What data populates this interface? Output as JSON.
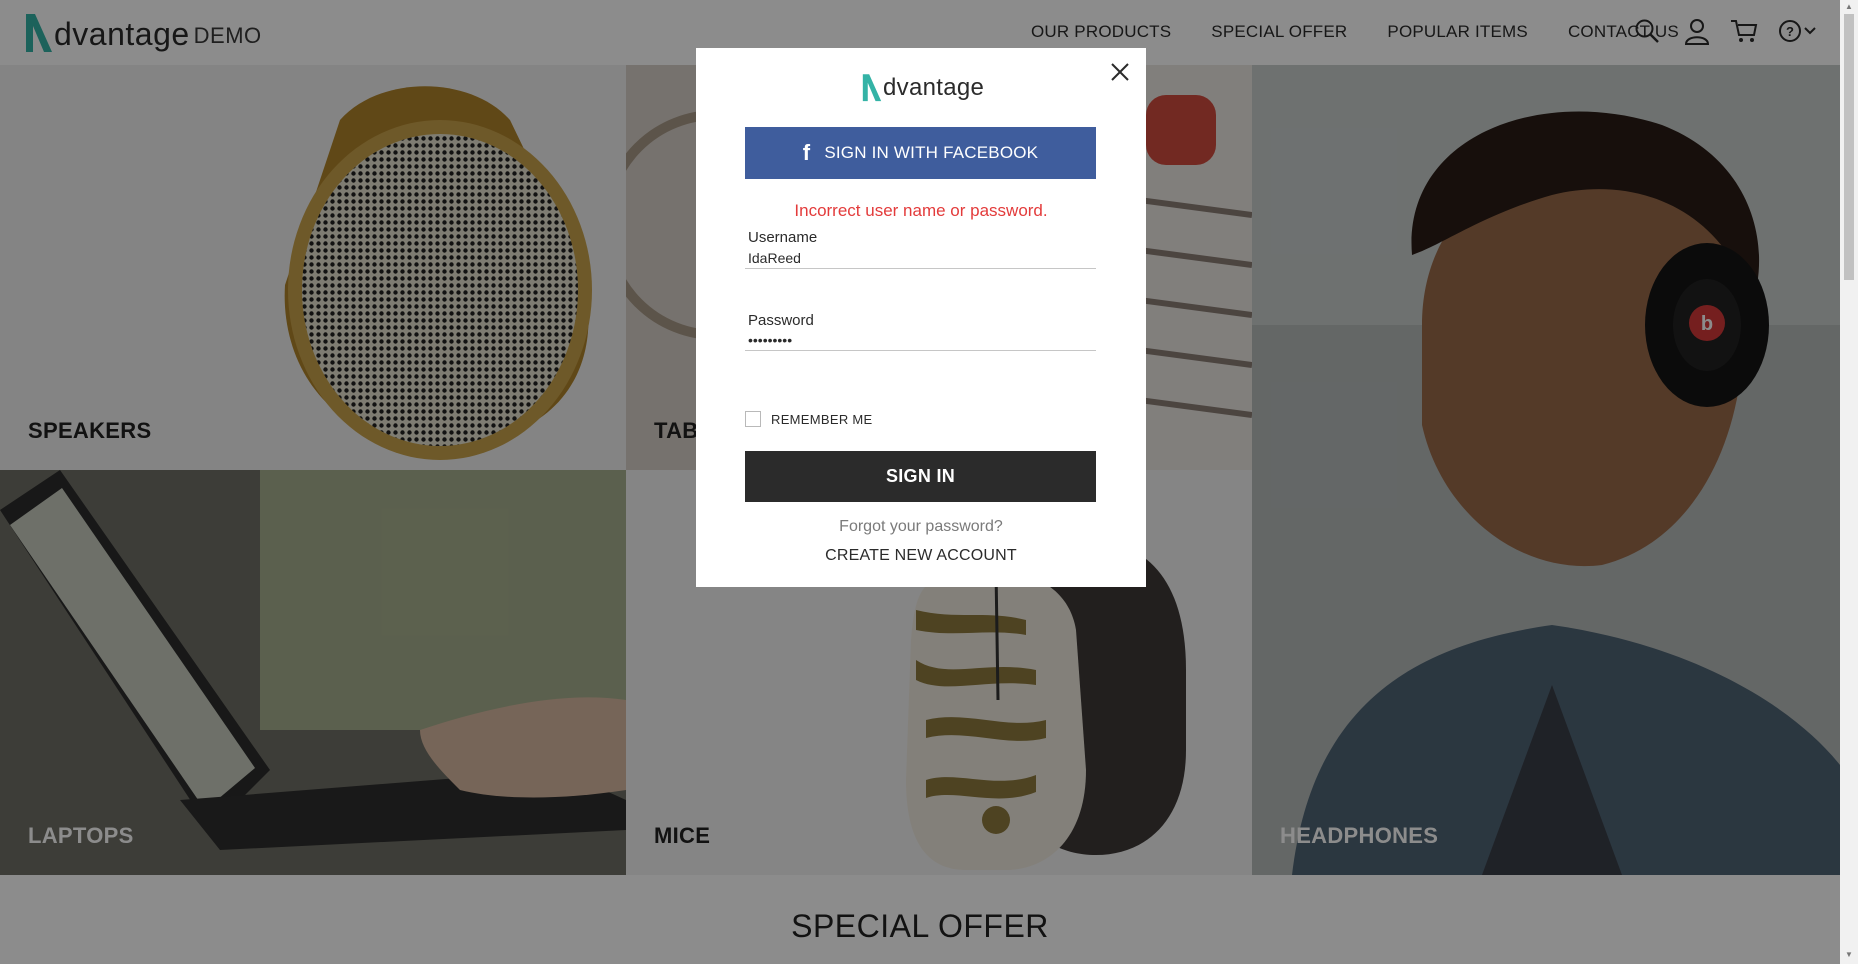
{
  "header": {
    "logo_word": "dvantage",
    "logo_demo": "DEMO",
    "nav": [
      "OUR PRODUCTS",
      "SPECIAL OFFER",
      "POPULAR ITEMS",
      "CONTACT US"
    ],
    "icons": [
      "search-icon",
      "user-icon",
      "cart-icon",
      "help-icon",
      "chevron-down-icon"
    ]
  },
  "categories": {
    "speakers": "SPEAKERS",
    "tablets": "TABLETS",
    "laptops": "LAPTOPS",
    "mice": "MICE",
    "headphones": "HEADPHONES"
  },
  "special_offer": {
    "title": "SPECIAL OFFER"
  },
  "modal": {
    "logo_word": "dvantage",
    "facebook_label": "SIGN IN WITH FACEBOOK",
    "error": "Incorrect user name or password.",
    "username_label": "Username",
    "username_value": "IdaReed",
    "password_label": "Password",
    "password_value": "•••••••••",
    "remember_label": "REMEMBER ME",
    "remember_checked": false,
    "signin_label": "SIGN IN",
    "forgot_label": "Forgot your password?",
    "create_label": "CREATE NEW ACCOUNT"
  },
  "colors": {
    "brand_teal": "#34b3a6",
    "facebook_blue": "#3f5d9d",
    "error_red": "#e33b3b",
    "button_dark": "#2b2b2b"
  }
}
